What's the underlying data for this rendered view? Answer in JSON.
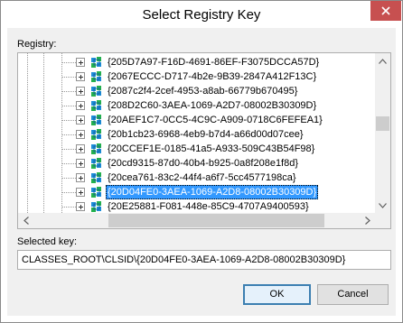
{
  "window": {
    "title": "Select Registry Key"
  },
  "labels": {
    "registry": "Registry:",
    "selected_key": "Selected key:"
  },
  "tree": {
    "rows": [
      {
        "text": "{205D7A97-F16D-4691-86EF-F3075DCCA57D}",
        "selected": false
      },
      {
        "text": "{2067ECCC-D717-4b2e-9B39-2847A412F13C}",
        "selected": false
      },
      {
        "text": "{2087c2f4-2cef-4953-a8ab-66779b670495}",
        "selected": false
      },
      {
        "text": "{208D2C60-3AEA-1069-A2D7-08002B30309D}",
        "selected": false
      },
      {
        "text": "{20AEF1C7-0CC5-4C9C-A909-0718C6FEFEA1}",
        "selected": false
      },
      {
        "text": "{20b1cb23-6968-4eb9-b7d4-a66d00d07cee}",
        "selected": false
      },
      {
        "text": "{20CCEF1E-0185-41a5-A933-509C43B54F98}",
        "selected": false
      },
      {
        "text": "{20cd9315-87d0-40b4-b925-0a8f208e1f8d}",
        "selected": false
      },
      {
        "text": "{20cea761-83c2-44f4-a6f7-5cc4577198ca}",
        "selected": false
      },
      {
        "text": "{20D04FE0-3AEA-1069-A2D8-08002B30309D}",
        "selected": true
      },
      {
        "text": "{20E25881-F081-448e-85C9-4707A9400593}",
        "selected": false
      }
    ]
  },
  "selected_key": {
    "value": "CLASSES_ROOT\\CLSID\\{20D04FE0-3AEA-1069-A2D8-08002B30309D}"
  },
  "buttons": {
    "ok": "OK",
    "cancel": "Cancel"
  },
  "icons": {
    "close": "close-icon",
    "folder": "registry-key-icon",
    "scroll_up": "chevron-up-icon",
    "scroll_down": "chevron-down-icon",
    "scroll_left": "chevron-left-icon",
    "scroll_right": "chevron-right-icon"
  },
  "colors": {
    "selection": "#3399ff",
    "close_button": "#c75050",
    "default_button_border": "#3c7fb1"
  }
}
